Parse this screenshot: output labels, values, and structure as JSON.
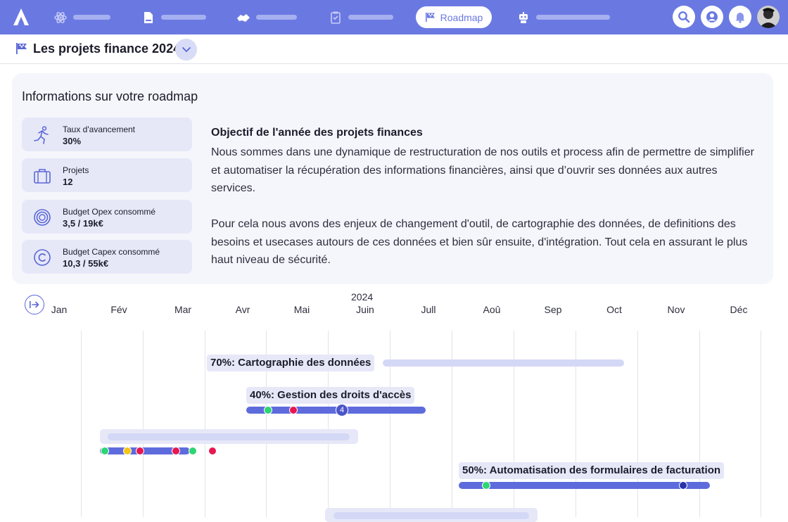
{
  "nav": {
    "active_label": "Roadmap",
    "icons": [
      "atom-icon",
      "document-icon",
      "handshake-icon",
      "clipboard-icon",
      "robot-icon"
    ]
  },
  "header": {
    "title": "Les projets finance 2024"
  },
  "info": {
    "title": "Informations sur votre roadmap",
    "stats": [
      {
        "label": "Taux d'avancement",
        "value": "30%",
        "icon": "running-icon"
      },
      {
        "label": "Projets",
        "value": "12",
        "icon": "briefcase-icon"
      },
      {
        "label": "Budget Opex consommé",
        "value": "3,5 / 19k€",
        "icon": "coin-icon"
      },
      {
        "label": "Budget Capex consommé",
        "value": "10,3 / 55k€",
        "icon": "copyright-icon"
      }
    ],
    "objective_title": "Objectif de l'année des projets finances",
    "objective_p1": "Nous sommes dans une dynamique de restructuration de nos outils et process afin de permettre de simplifier et automatiser la récupération des informations financières, ainsi que d’ouvrir ses données aux autres services.",
    "objective_p2": "Pour cela nous avons des enjeux de changement d'outil, de cartographie des données, de definitions des besoins et usecases autours de ces données et bien sûr ensuite, d'intégration. Tout cela en assurant le plus haut niveau de sécurité."
  },
  "timeline": {
    "year": "2024",
    "months": [
      "Jan",
      "Fév",
      "Mar",
      "Avr",
      "Mai",
      "Juin",
      "Jull",
      "Aoû",
      "Sep",
      "Oct",
      "Nov",
      "Déc"
    ],
    "projects": [
      {
        "label": "70%: Cartographie des données",
        "progress": 0.7
      },
      {
        "label": "40%: Gestion des droits d'accès",
        "progress": 0.4,
        "milestone_count": "4"
      },
      {
        "label": "",
        "progress": null
      },
      {
        "label": "50%:  Automatisation des formulaires de facturation",
        "progress": 0.5
      }
    ],
    "colors": {
      "bar": "#5e6bdc",
      "ghost": "#e6e8f8",
      "green": "#2ed573",
      "yellow": "#f5c518",
      "red": "#e8174f",
      "navy": "#2833a8"
    }
  }
}
